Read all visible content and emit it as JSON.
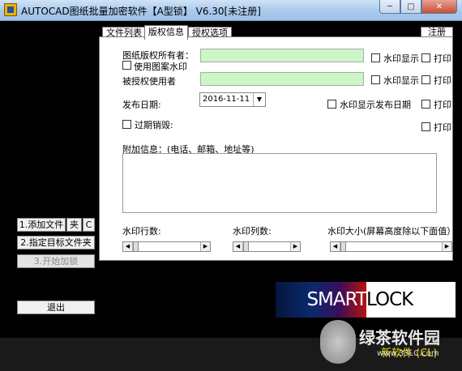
{
  "window": {
    "title": "AUTOCAD图纸批量加密软件【A型锁】 V6.30[未注册]",
    "controls": {
      "minimize": "─",
      "maximize": "□",
      "close": "✕"
    }
  },
  "tabs": [
    {
      "label": "文件列表"
    },
    {
      "label": "版权信息"
    },
    {
      "label": "授权选项"
    }
  ],
  "register_label": "注册",
  "form": {
    "owner_label": "图纸版权所有者：",
    "use_pattern_label": "使用图案水印",
    "licensee_label": "被授权使用者",
    "watermark_show_label": "水印显示",
    "print_label": "打印",
    "date_label": "发布日期:",
    "date_value": "2016-11-11",
    "watermark_date_label": "水印显示发布日期",
    "expire_label": "过期销毁:",
    "extra_info_label": "附加信息：(电话、邮箱、地址等)",
    "rows_label": "水印行数:",
    "cols_label": "水印列数:",
    "size_label": "水印大小(屏幕高度除以下面值）:"
  },
  "left_buttons": {
    "add_file": "1.添加文件",
    "folder": "夹",
    "c": "C",
    "target_folder": "2.指定目标文件夹",
    "start_encrypt": "3.开始加锁",
    "exit": "退出"
  },
  "logo": {
    "part1": "SMART",
    "part2": "LOCK"
  },
  "watermark": {
    "brand": "绿茶软件园",
    "url": "www.33LC.com"
  },
  "status": {
    "text": "新软件 (CL)"
  },
  "colors": {
    "field_green": "#ccf6c6",
    "status_yellow": "#e6d200"
  }
}
